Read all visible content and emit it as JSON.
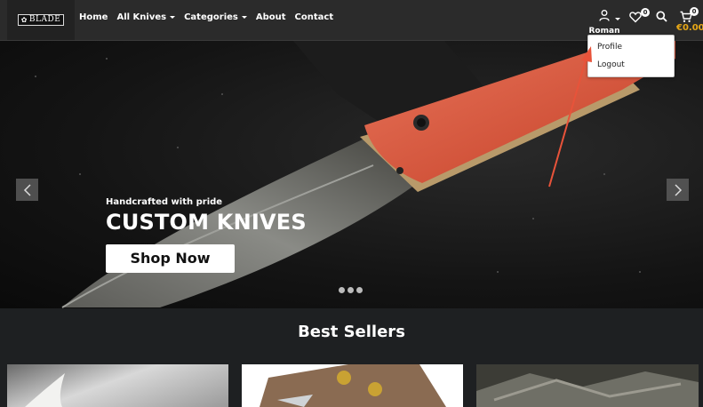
{
  "header": {
    "logo_text": "BLADE",
    "nav": [
      "Home",
      "All Knives",
      "Categories",
      "About",
      "Contact"
    ],
    "user_name": "Roman",
    "wishlist_count": "0",
    "cart_count": "0",
    "cart_total": "€0.00"
  },
  "user_menu": {
    "profile": "Profile",
    "logout": "Logout"
  },
  "hero": {
    "tagline": "Handcrafted with pride",
    "headline": "CUSTOM KNIVES",
    "cta": "Shop Now",
    "slides": 3
  },
  "best_sellers": {
    "title": "Best Sellers"
  },
  "colors": {
    "accent": "#e8a817",
    "annotation_arrow": "#e8533a"
  }
}
